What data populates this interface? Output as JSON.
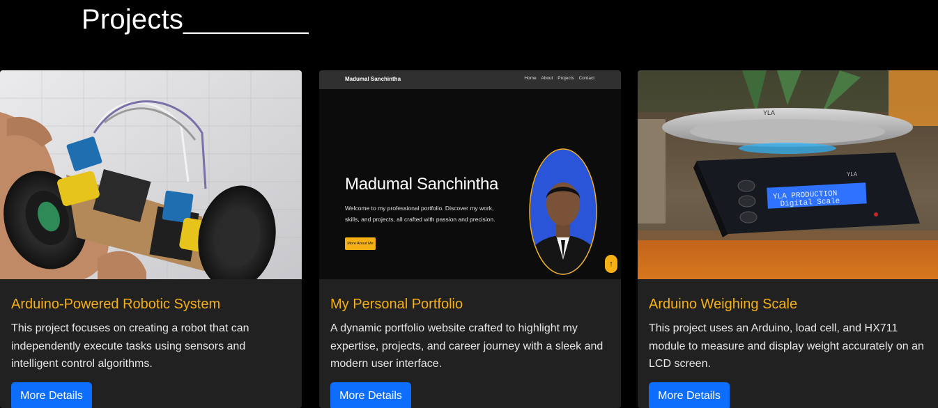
{
  "section": {
    "title": "Projects________"
  },
  "projects": [
    {
      "title": "Arduino-Powered Robotic System",
      "description": "This project focuses on creating a robot that can independently execute tasks using sensors and intelligent control algorithms.",
      "button_label": "More Details"
    },
    {
      "title": "My Personal Portfolio",
      "description": "A dynamic portfolio website crafted to highlight my expertise, projects, and career journey with a sleek and modern user interface.",
      "button_label": "More Details",
      "preview": {
        "brand": "Madumal Sanchintha",
        "nav_links": [
          "Home",
          "About",
          "Projects",
          "Contact"
        ],
        "hero_name": "Madumal Sanchintha",
        "hero_text": "Welcome to my professional portfolio. Discover my work, skills, and projects, all crafted with passion and precision.",
        "hero_button": "More About Me",
        "scroll_icon": "↑"
      }
    },
    {
      "title": "Arduino Weighing Scale",
      "description": "This project uses an Arduino, load cell, and HX711 module to measure and display weight accurately on an LCD screen.",
      "button_label": "More Details",
      "preview": {
        "lcd_line1": "YLA PRODUCTION",
        "lcd_line2": "Digital Scale",
        "plate_label": "YLA",
        "device_label": "YLA"
      }
    }
  ],
  "colors": {
    "accent": "#f5b015",
    "button": "#0d6efd",
    "card_bg": "#212121",
    "page_bg": "#000000"
  }
}
